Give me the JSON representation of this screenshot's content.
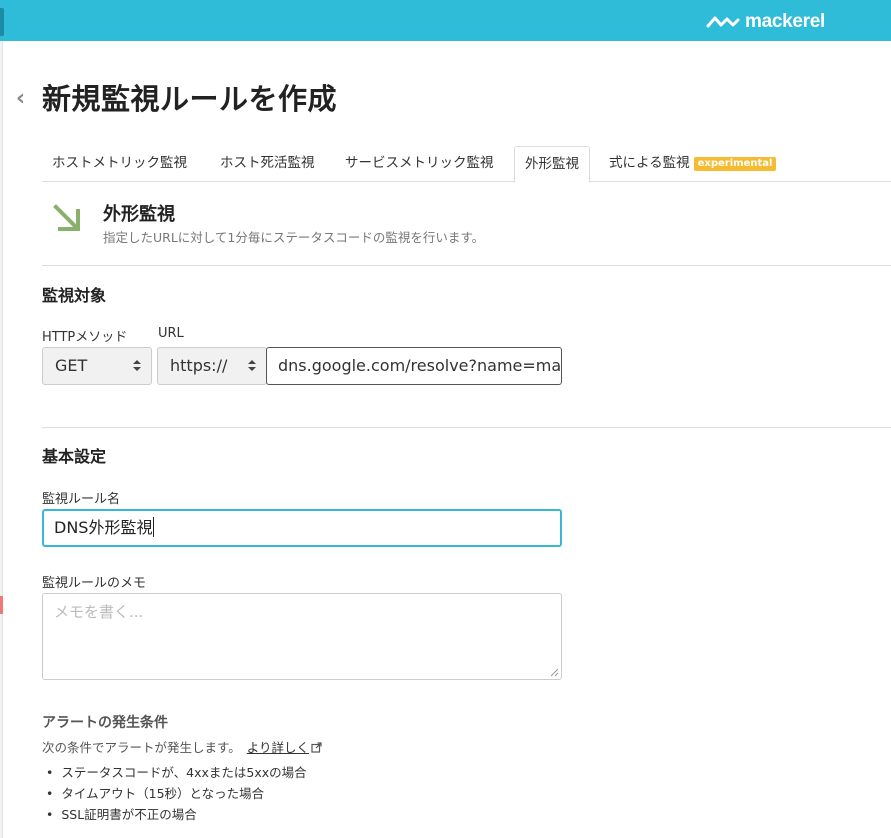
{
  "header": {
    "brand": "mackerel"
  },
  "page": {
    "title": "新規監視ルールを作成",
    "back_icon": "chevron-left-icon"
  },
  "tabs": [
    {
      "label": "ホストメトリック監視"
    },
    {
      "label": "ホスト死活監視"
    },
    {
      "label": "サービスメトリック監視"
    },
    {
      "label": "外形監視",
      "active": true
    },
    {
      "label": "式による監視",
      "badge": "experimental"
    }
  ],
  "section": {
    "title": "外形監視",
    "description": "指定したURLに対して1分毎にステータスコードの監視を行います。"
  },
  "target": {
    "heading": "監視対象",
    "method_label": "HTTPメソッド",
    "method_value": "GET",
    "url_label": "URL",
    "scheme_value": "https://",
    "url_value": "dns.google.com/resolve?name=ma"
  },
  "basic": {
    "heading": "基本設定",
    "name_label": "監視ルール名",
    "name_value": "DNS外形監視",
    "memo_label": "監視ルールのメモ",
    "memo_placeholder": "メモを書く..."
  },
  "alert": {
    "title": "アラートの発生条件",
    "description": "次の条件でアラートが発生します。",
    "link": "より詳しく",
    "conditions": [
      "ステータスコードが、4xxまたは5xxの場合",
      "タイムアウト（15秒）となった場合",
      "SSL証明書が不正の場合"
    ]
  },
  "colors": {
    "header": "#2fbcd9",
    "focus": "#3bb7d4",
    "badge": "#f6bb30",
    "icon": "#8ab06e"
  }
}
